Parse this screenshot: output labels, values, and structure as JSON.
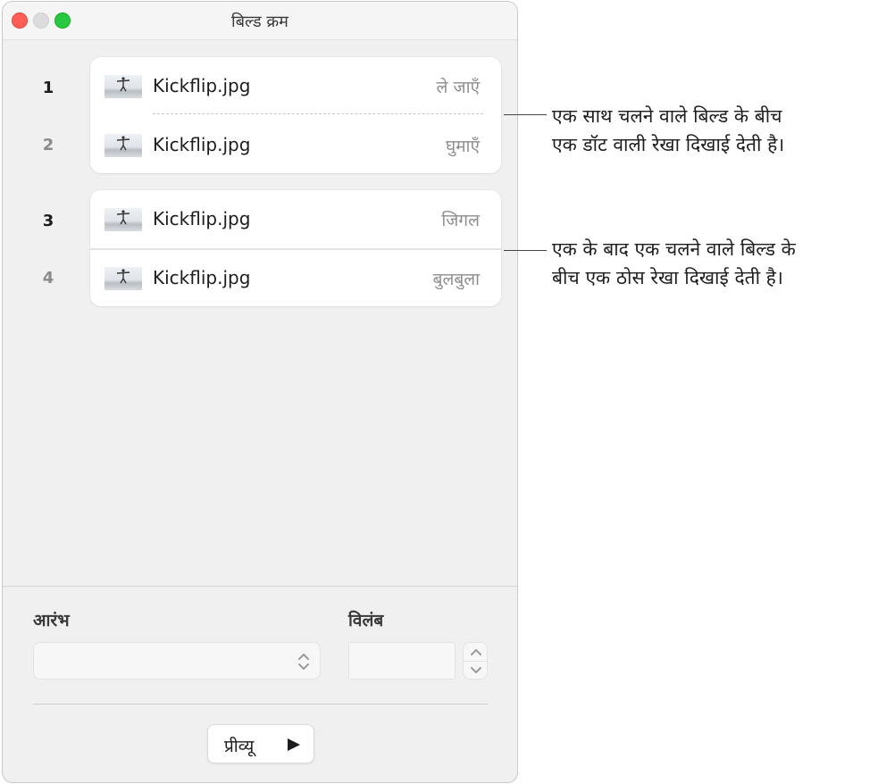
{
  "window": {
    "title": "बिल्ड क्रम",
    "controls": {
      "close_color": "#ff5f57",
      "minimize_color": "#dcdcdc",
      "zoom_color": "#28c840"
    }
  },
  "builds": [
    {
      "number": "1",
      "file": "Kickflip.jpg",
      "effect": "ले जाएँ"
    },
    {
      "number": "2",
      "file": "Kickflip.jpg",
      "effect": "घुमाएँ"
    },
    {
      "number": "3",
      "file": "Kickflip.jpg",
      "effect": "जिगल"
    },
    {
      "number": "4",
      "file": "Kickflip.jpg",
      "effect": "बुलबुला"
    }
  ],
  "settings": {
    "start_label": "आरंभ",
    "start_value": "",
    "delay_label": "विलंब",
    "delay_value": "",
    "preview_label": "प्रीव्यू"
  },
  "callouts": {
    "dotted": {
      "line1": "एक साथ चलने वाले बिल्ड के बीच",
      "line2": "एक डॉट वाली रेखा दिखाई देती है।"
    },
    "solid": {
      "line1": "एक के बाद एक चलने वाले बिल्ड के",
      "line2": "बीच एक ठोस रेखा दिखाई देती है।"
    }
  },
  "icons": {
    "thumbnail": "skateboarder-photo-thumbnail",
    "select_arrows": "up-down-chevron-icon",
    "play": "play-triangle-icon"
  }
}
